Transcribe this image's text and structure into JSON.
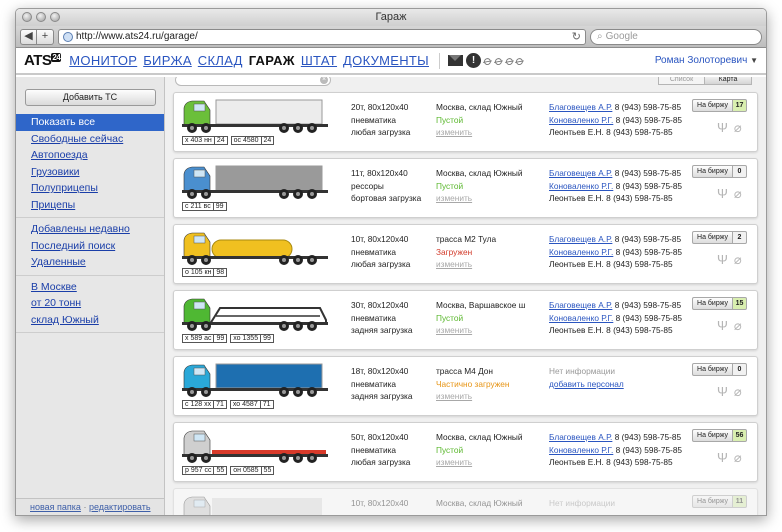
{
  "window": {
    "title": "Гараж"
  },
  "browser": {
    "url": "http://www.ats24.ru/garage/",
    "search_placeholder": "Google",
    "back": "◀",
    "forward": "+"
  },
  "header": {
    "logo": "ATS",
    "logo_sup": "24",
    "nav": [
      {
        "label": "МОНИТОР",
        "active": false
      },
      {
        "label": "БИРЖА",
        "active": false
      },
      {
        "label": "СКЛАД",
        "active": false
      },
      {
        "label": "ГАРАЖ",
        "active": true
      },
      {
        "label": "ШТАТ",
        "active": false
      },
      {
        "label": "ДОКУМЕНТЫ",
        "active": false
      }
    ],
    "user": "Роман Золоторевич"
  },
  "sidebar": {
    "add_button": "Добавить ТС",
    "groups": [
      [
        "Показать все",
        "Свободные сейчас",
        "Автопоезда",
        "Грузовики",
        "Полуприцепы",
        "Прицепы"
      ],
      [
        "Добавлены недавно",
        "Последний поиск",
        "Удаленные"
      ],
      [
        "В Москве",
        "от 20 тонн",
        "склад Южный"
      ]
    ],
    "active_item": "Показать все",
    "footer_new_folder": "новая папка",
    "footer_sep": "·",
    "footer_edit": "редактировать"
  },
  "main": {
    "view_list": "Список",
    "view_map": "Карта",
    "exchange_label": "На биржу",
    "vehicles": [
      {
        "truck": "green-cab-tarp-trailer",
        "cab_color": "#6bbf3a",
        "body_color": "#ececec",
        "plates": [
          {
            "n": "х 403 нн",
            "r": "24"
          },
          {
            "n": "ос 4580",
            "r": "24"
          }
        ],
        "spec": [
          "20т, 80x120x40",
          "пневматика",
          "любая загрузка"
        ],
        "location": "Москва, склад Южный",
        "status": "Пустой",
        "status_kind": "free",
        "edit": "изменить",
        "contacts": [
          {
            "name": "Благовещев А.Р.",
            "phone": "8 (943) 598-75-85",
            "link": true
          },
          {
            "name": "Коноваленко Р.Г.",
            "phone": "8 (943) 598-75-85",
            "link": true
          },
          {
            "name": "Леонтьев Е.Н.",
            "phone": "8 (943) 598-75-85",
            "link": false
          }
        ],
        "count": "17",
        "count_kind": "hot"
      },
      {
        "truck": "blue-cab-box-truck",
        "cab_color": "#4a8fcf",
        "body_color": "#9a9a9a",
        "plates": [
          {
            "n": "с 211 вс",
            "r": "99"
          }
        ],
        "spec": [
          "11т, 80x120x40",
          "рессоры",
          "бортовая загрузка"
        ],
        "location": "Москва, склад Южный",
        "status": "Пустой",
        "status_kind": "free",
        "edit": "изменить",
        "contacts": [
          {
            "name": "Благовещев А.Р.",
            "phone": "8 (943) 598-75-85",
            "link": true
          },
          {
            "name": "Коноваленко Р.Г.",
            "phone": "8 (943) 598-75-85",
            "link": true
          },
          {
            "name": "Леонтьев Е.Н.",
            "phone": "8 (943) 598-75-85",
            "link": false
          }
        ],
        "count": "0",
        "count_kind": "zero"
      },
      {
        "truck": "yellow-tanker",
        "cab_color": "#f0c020",
        "body_color": "#f0c020",
        "plates": [
          {
            "n": "о 105 кн",
            "r": "98"
          }
        ],
        "spec": [
          "10т, 80x120x40",
          "пневматика",
          "любая загрузка"
        ],
        "location": "трасса М2 Тула",
        "status": "Загружен",
        "status_kind": "loaded",
        "edit": "изменить",
        "contacts": [
          {
            "name": "Благовещев А.Р.",
            "phone": "8 (943) 598-75-85",
            "link": true
          },
          {
            "name": "Коноваленко Р.Г.",
            "phone": "8 (943) 598-75-85",
            "link": true
          },
          {
            "name": "Леонтьев Е.Н.",
            "phone": "8 (943) 598-75-85",
            "link": false
          }
        ],
        "count": "2",
        "count_kind": "zero"
      },
      {
        "truck": "green-cab-car-carrier",
        "cab_color": "#4fb833",
        "body_color": "#555555",
        "plates": [
          {
            "n": "х 589 ас",
            "r": "99"
          },
          {
            "n": "хо 1355",
            "r": "99"
          }
        ],
        "spec": [
          "30т, 80x120x40",
          "пневматика",
          "задняя загрузка"
        ],
        "location": "Москва, Варшавское ш",
        "status": "Пустой",
        "status_kind": "free",
        "edit": "изменить",
        "contacts": [
          {
            "name": "Благовещев А.Р.",
            "phone": "8 (943) 598-75-85",
            "link": true
          },
          {
            "name": "Коноваленко Р.Г.",
            "phone": "8 (943) 598-75-85",
            "link": true
          },
          {
            "name": "Леонтьев Е.Н.",
            "phone": "8 (943) 598-75-85",
            "link": false
          }
        ],
        "count": "15",
        "count_kind": "hot"
      },
      {
        "truck": "cyan-cab-container",
        "cab_color": "#2aa8d8",
        "body_color": "#1e6fb0",
        "plates": [
          {
            "n": "с 128 хх",
            "r": "71"
          },
          {
            "n": "хо 4587",
            "r": "71"
          }
        ],
        "spec": [
          "18т, 80x120x40",
          "пневматика",
          "задняя загрузка"
        ],
        "location": "трасса М4 Дон",
        "status": "Частично загружен",
        "status_kind": "partial",
        "edit": "изменить",
        "no_info": "Нет информации",
        "add_staff": "добавить персонал",
        "contacts": [],
        "count": "0",
        "count_kind": "zero"
      },
      {
        "truck": "grey-cab-flatbed",
        "cab_color": "#cfcfcf",
        "body_color": "#d83a2a",
        "plates": [
          {
            "n": "р 957 сс",
            "r": "55"
          },
          {
            "n": "он 0585",
            "r": "55"
          }
        ],
        "spec": [
          "50т, 80x120x40",
          "пневматика",
          "любая загрузка"
        ],
        "location": "Москва, склад Южный",
        "status": "Пустой",
        "status_kind": "free",
        "edit": "изменить",
        "contacts": [
          {
            "name": "Благовещев А.Р.",
            "phone": "8 (943) 598-75-85",
            "link": true
          },
          {
            "name": "Коноваленко Р.Г.",
            "phone": "8 (943) 598-75-85",
            "link": true
          },
          {
            "name": "Леонтьев Е.Н.",
            "phone": "8 (943) 598-75-85",
            "link": false
          }
        ],
        "count": "56",
        "count_kind": "hot"
      },
      {
        "truck": "faded-truck",
        "cab_color": "#cccccc",
        "body_color": "#dddddd",
        "faded": true,
        "plates": [],
        "spec": [
          "10т, 80x120x40"
        ],
        "location": "Москва, склад Южный",
        "status": "",
        "status_kind": "free",
        "edit": "",
        "no_info": "Нет информации",
        "contacts": [],
        "count": "11",
        "count_kind": "hot"
      }
    ]
  }
}
